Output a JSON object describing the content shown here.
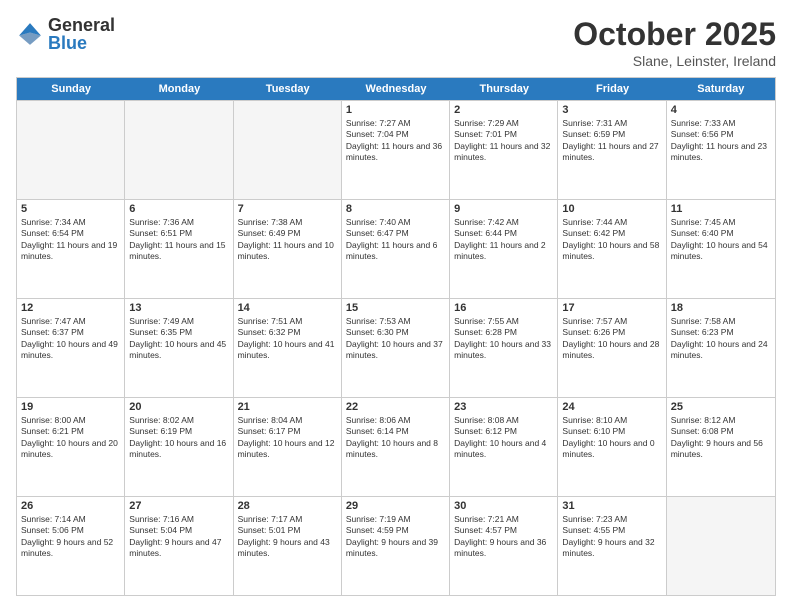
{
  "logo": {
    "general": "General",
    "blue": "Blue"
  },
  "title": "October 2025",
  "subtitle": "Slane, Leinster, Ireland",
  "days": [
    "Sunday",
    "Monday",
    "Tuesday",
    "Wednesday",
    "Thursday",
    "Friday",
    "Saturday"
  ],
  "weeks": [
    [
      {
        "day": "",
        "empty": true
      },
      {
        "day": "",
        "empty": true
      },
      {
        "day": "",
        "empty": true
      },
      {
        "day": "1",
        "sunrise": "7:27 AM",
        "sunset": "7:04 PM",
        "daylight": "11 hours and 36 minutes."
      },
      {
        "day": "2",
        "sunrise": "7:29 AM",
        "sunset": "7:01 PM",
        "daylight": "11 hours and 32 minutes."
      },
      {
        "day": "3",
        "sunrise": "7:31 AM",
        "sunset": "6:59 PM",
        "daylight": "11 hours and 27 minutes."
      },
      {
        "day": "4",
        "sunrise": "7:33 AM",
        "sunset": "6:56 PM",
        "daylight": "11 hours and 23 minutes."
      }
    ],
    [
      {
        "day": "5",
        "sunrise": "7:34 AM",
        "sunset": "6:54 PM",
        "daylight": "11 hours and 19 minutes."
      },
      {
        "day": "6",
        "sunrise": "7:36 AM",
        "sunset": "6:51 PM",
        "daylight": "11 hours and 15 minutes."
      },
      {
        "day": "7",
        "sunrise": "7:38 AM",
        "sunset": "6:49 PM",
        "daylight": "11 hours and 10 minutes."
      },
      {
        "day": "8",
        "sunrise": "7:40 AM",
        "sunset": "6:47 PM",
        "daylight": "11 hours and 6 minutes."
      },
      {
        "day": "9",
        "sunrise": "7:42 AM",
        "sunset": "6:44 PM",
        "daylight": "11 hours and 2 minutes."
      },
      {
        "day": "10",
        "sunrise": "7:44 AM",
        "sunset": "6:42 PM",
        "daylight": "10 hours and 58 minutes."
      },
      {
        "day": "11",
        "sunrise": "7:45 AM",
        "sunset": "6:40 PM",
        "daylight": "10 hours and 54 minutes."
      }
    ],
    [
      {
        "day": "12",
        "sunrise": "7:47 AM",
        "sunset": "6:37 PM",
        "daylight": "10 hours and 49 minutes."
      },
      {
        "day": "13",
        "sunrise": "7:49 AM",
        "sunset": "6:35 PM",
        "daylight": "10 hours and 45 minutes."
      },
      {
        "day": "14",
        "sunrise": "7:51 AM",
        "sunset": "6:32 PM",
        "daylight": "10 hours and 41 minutes."
      },
      {
        "day": "15",
        "sunrise": "7:53 AM",
        "sunset": "6:30 PM",
        "daylight": "10 hours and 37 minutes."
      },
      {
        "day": "16",
        "sunrise": "7:55 AM",
        "sunset": "6:28 PM",
        "daylight": "10 hours and 33 minutes."
      },
      {
        "day": "17",
        "sunrise": "7:57 AM",
        "sunset": "6:26 PM",
        "daylight": "10 hours and 28 minutes."
      },
      {
        "day": "18",
        "sunrise": "7:58 AM",
        "sunset": "6:23 PM",
        "daylight": "10 hours and 24 minutes."
      }
    ],
    [
      {
        "day": "19",
        "sunrise": "8:00 AM",
        "sunset": "6:21 PM",
        "daylight": "10 hours and 20 minutes."
      },
      {
        "day": "20",
        "sunrise": "8:02 AM",
        "sunset": "6:19 PM",
        "daylight": "10 hours and 16 minutes."
      },
      {
        "day": "21",
        "sunrise": "8:04 AM",
        "sunset": "6:17 PM",
        "daylight": "10 hours and 12 minutes."
      },
      {
        "day": "22",
        "sunrise": "8:06 AM",
        "sunset": "6:14 PM",
        "daylight": "10 hours and 8 minutes."
      },
      {
        "day": "23",
        "sunrise": "8:08 AM",
        "sunset": "6:12 PM",
        "daylight": "10 hours and 4 minutes."
      },
      {
        "day": "24",
        "sunrise": "8:10 AM",
        "sunset": "6:10 PM",
        "daylight": "10 hours and 0 minutes."
      },
      {
        "day": "25",
        "sunrise": "8:12 AM",
        "sunset": "6:08 PM",
        "daylight": "9 hours and 56 minutes."
      }
    ],
    [
      {
        "day": "26",
        "sunrise": "7:14 AM",
        "sunset": "5:06 PM",
        "daylight": "9 hours and 52 minutes."
      },
      {
        "day": "27",
        "sunrise": "7:16 AM",
        "sunset": "5:04 PM",
        "daylight": "9 hours and 47 minutes."
      },
      {
        "day": "28",
        "sunrise": "7:17 AM",
        "sunset": "5:01 PM",
        "daylight": "9 hours and 43 minutes."
      },
      {
        "day": "29",
        "sunrise": "7:19 AM",
        "sunset": "4:59 PM",
        "daylight": "9 hours and 39 minutes."
      },
      {
        "day": "30",
        "sunrise": "7:21 AM",
        "sunset": "4:57 PM",
        "daylight": "9 hours and 36 minutes."
      },
      {
        "day": "31",
        "sunrise": "7:23 AM",
        "sunset": "4:55 PM",
        "daylight": "9 hours and 32 minutes."
      },
      {
        "day": "",
        "empty": true
      }
    ]
  ]
}
